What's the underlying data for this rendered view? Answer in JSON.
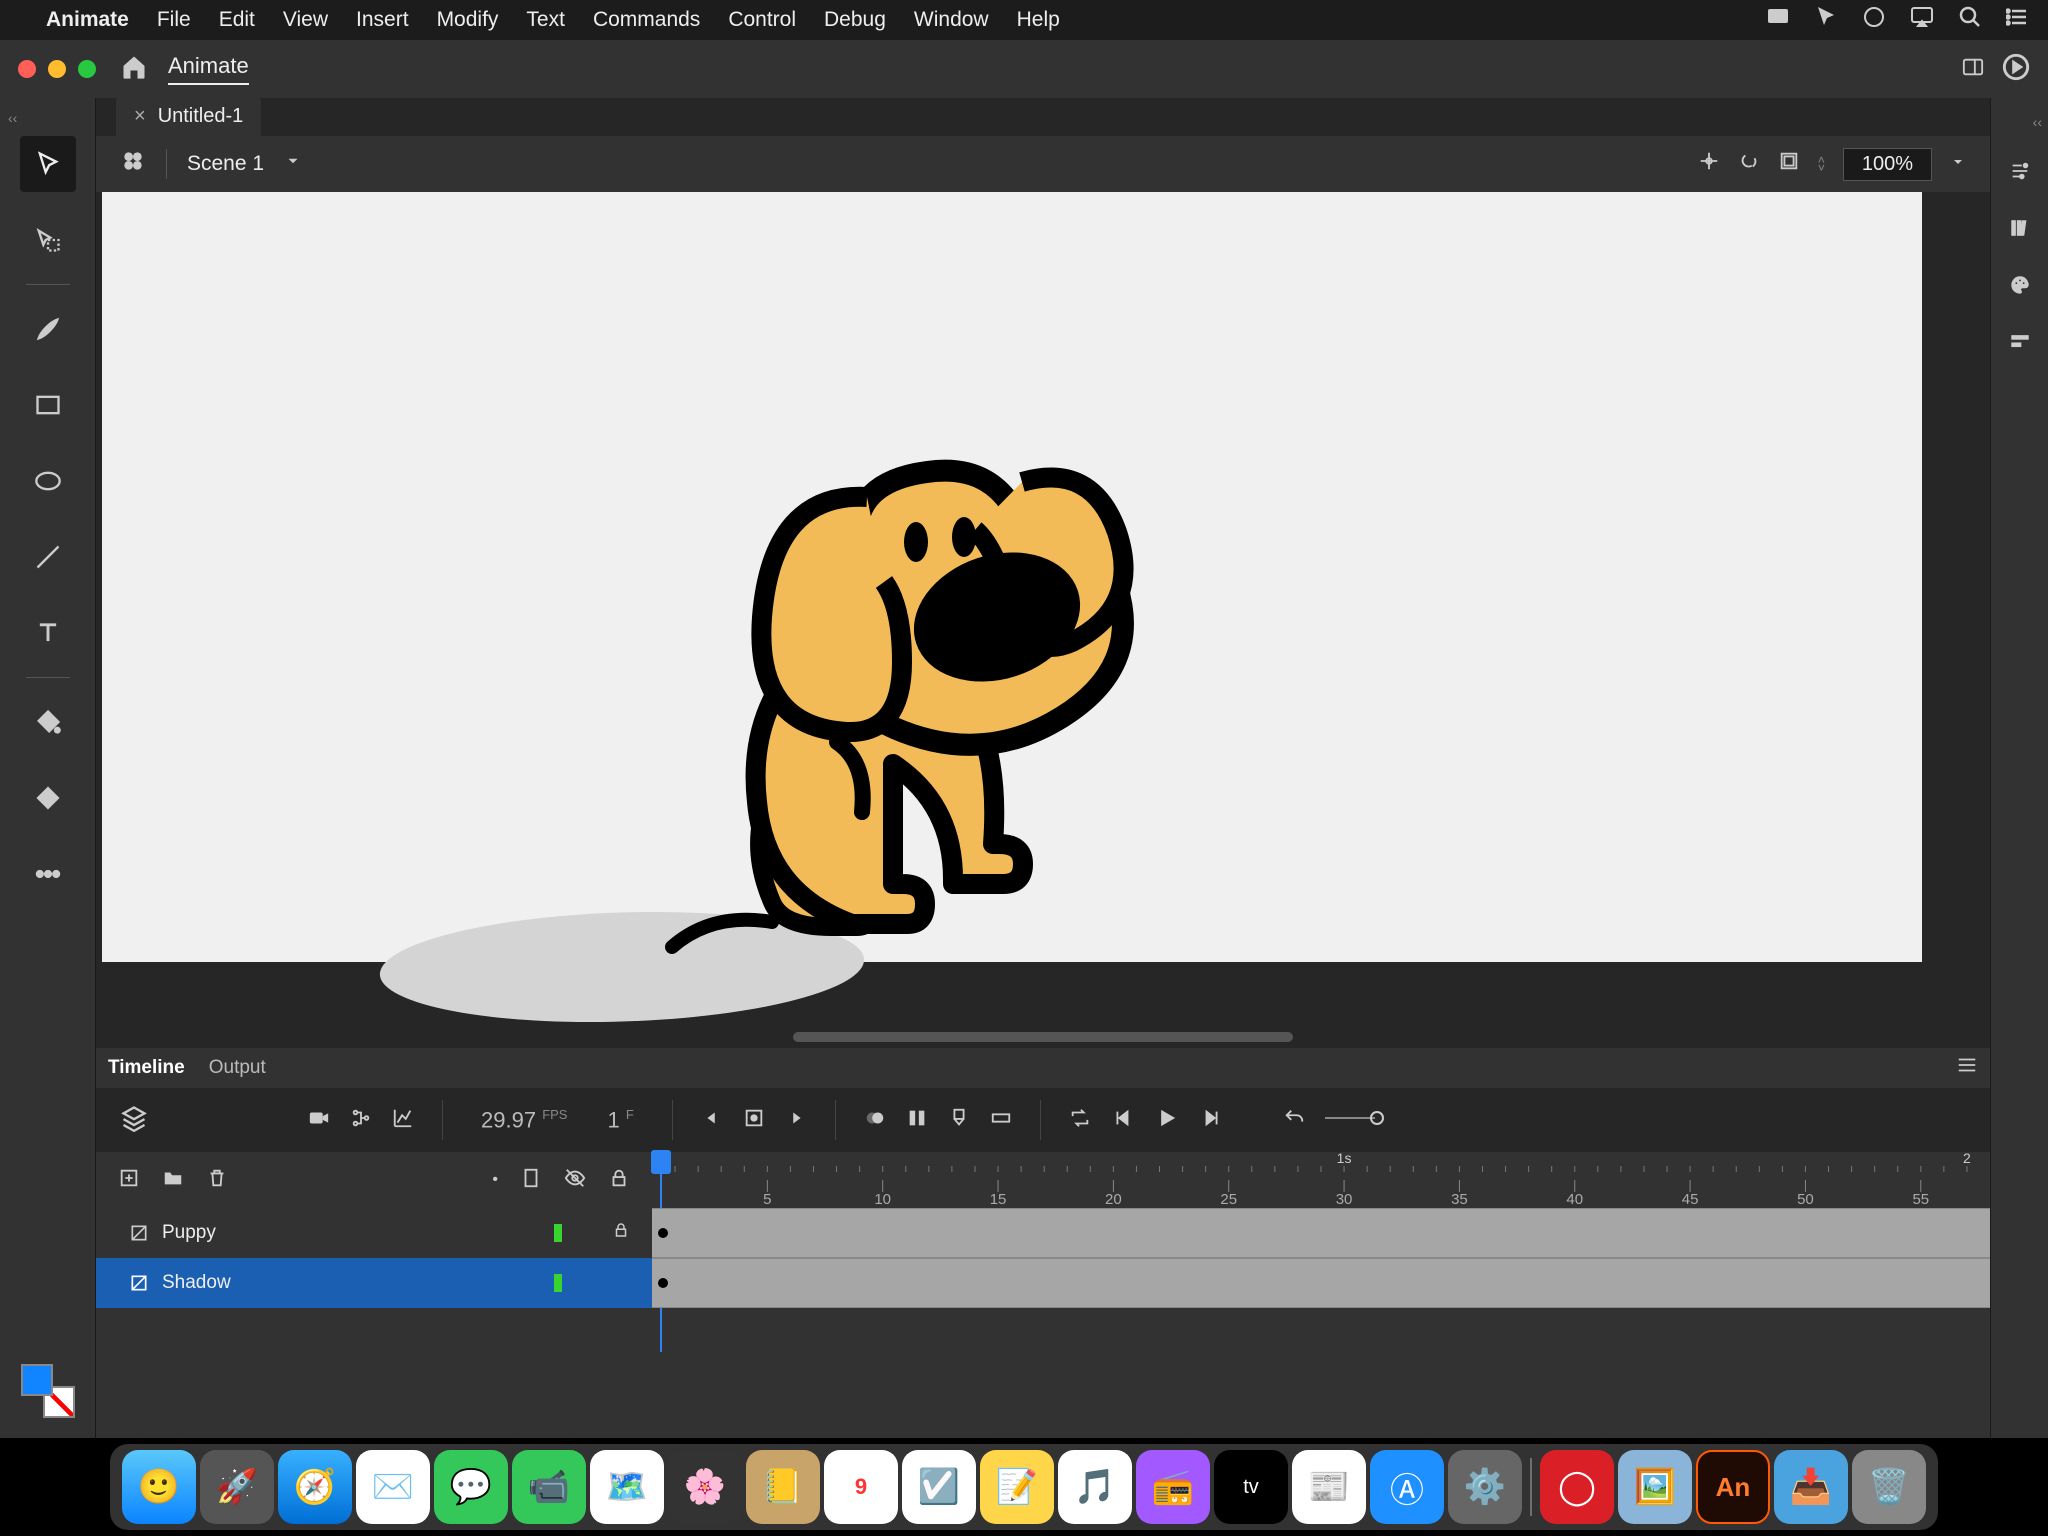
{
  "menubar": {
    "app": "Animate",
    "items": [
      "File",
      "Edit",
      "View",
      "Insert",
      "Modify",
      "Text",
      "Commands",
      "Control",
      "Debug",
      "Window",
      "Help"
    ]
  },
  "winbar": {
    "workspace": "Animate"
  },
  "document": {
    "tab": "Untitled-1",
    "scene": "Scene 1",
    "zoom": "100%"
  },
  "timeline": {
    "tabs": [
      "Timeline",
      "Output"
    ],
    "active_tab": "Timeline",
    "fps_value": "29.97",
    "fps_label": "FPS",
    "frame_value": "1",
    "frame_label": "F",
    "ruler": {
      "second_marker": "1s",
      "end_marker": "2",
      "ticks": [
        "5",
        "10",
        "15",
        "20",
        "25",
        "30",
        "35",
        "40",
        "45",
        "50",
        "55"
      ]
    },
    "layers": [
      {
        "name": "Puppy",
        "locked": true,
        "selected": false
      },
      {
        "name": "Shadow",
        "locked": false,
        "selected": true
      }
    ]
  },
  "colors": {
    "fill": "#1184ff",
    "stroke": "#ffffff",
    "accent": "#2d83f3",
    "dog_body": "#f2bb57"
  }
}
